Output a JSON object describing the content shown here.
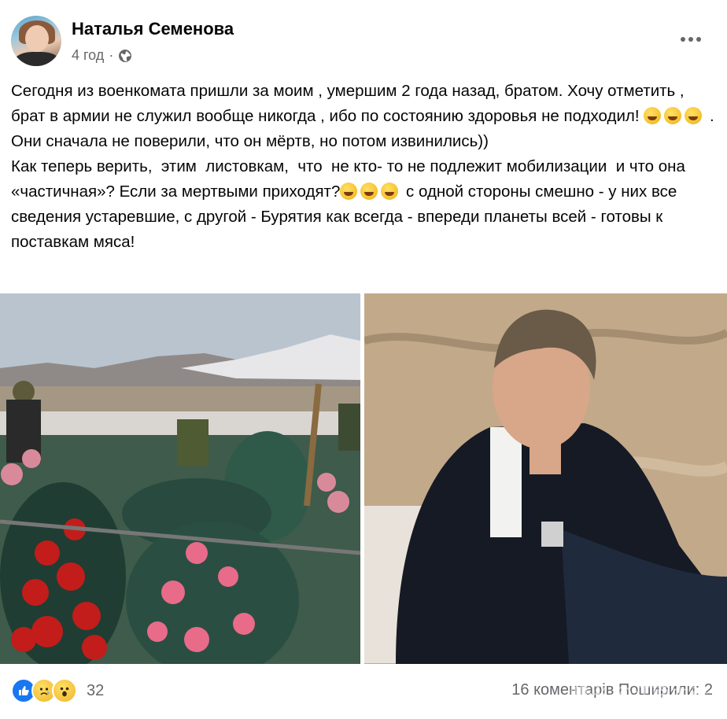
{
  "post": {
    "author": "Наталья Семенова",
    "time": "4 год",
    "separator": "·",
    "privacy_icon": "globe-icon",
    "more_icon": "more-horizontal-icon",
    "paragraph1_a": "Сегодня из военкомата пришли за моим , умершим 2 года назад, братом. Хочу отметить , брат в армии не служил вообще никогда , ибо по состоянию здоровья не подходил! ",
    "paragraph1_b": " . Они сначала не поверили, что он мёртв, но потом извинились))",
    "paragraph2_a": "Как теперь верить,  этим  листовкам,  что  не кто- то не подлежит мобилизации  и что она «частичная»? Если за мертвыми приходят?",
    "paragraph2_b": " с одной стороны смешно - у них все сведения устаревшие, с другой - Бурятия как всегда - впереди планеты всей - готовы к поставкам мяса!",
    "emoji_name": "rolling-on-floor-laughing"
  },
  "photos": {
    "left_alt": "cemetery with wreaths and hills",
    "right_alt": "young man sitting on sand"
  },
  "footer": {
    "reaction_icons": [
      "like-icon",
      "sad-icon",
      "wow-icon"
    ],
    "reaction_count": "32",
    "comments_text": "16 коментарів  Поширили: 2",
    "watermark": "知乎 @江南木进"
  },
  "colors": {
    "text": "#050505",
    "secondary": "#65676b",
    "like_blue": "#1877f2"
  }
}
